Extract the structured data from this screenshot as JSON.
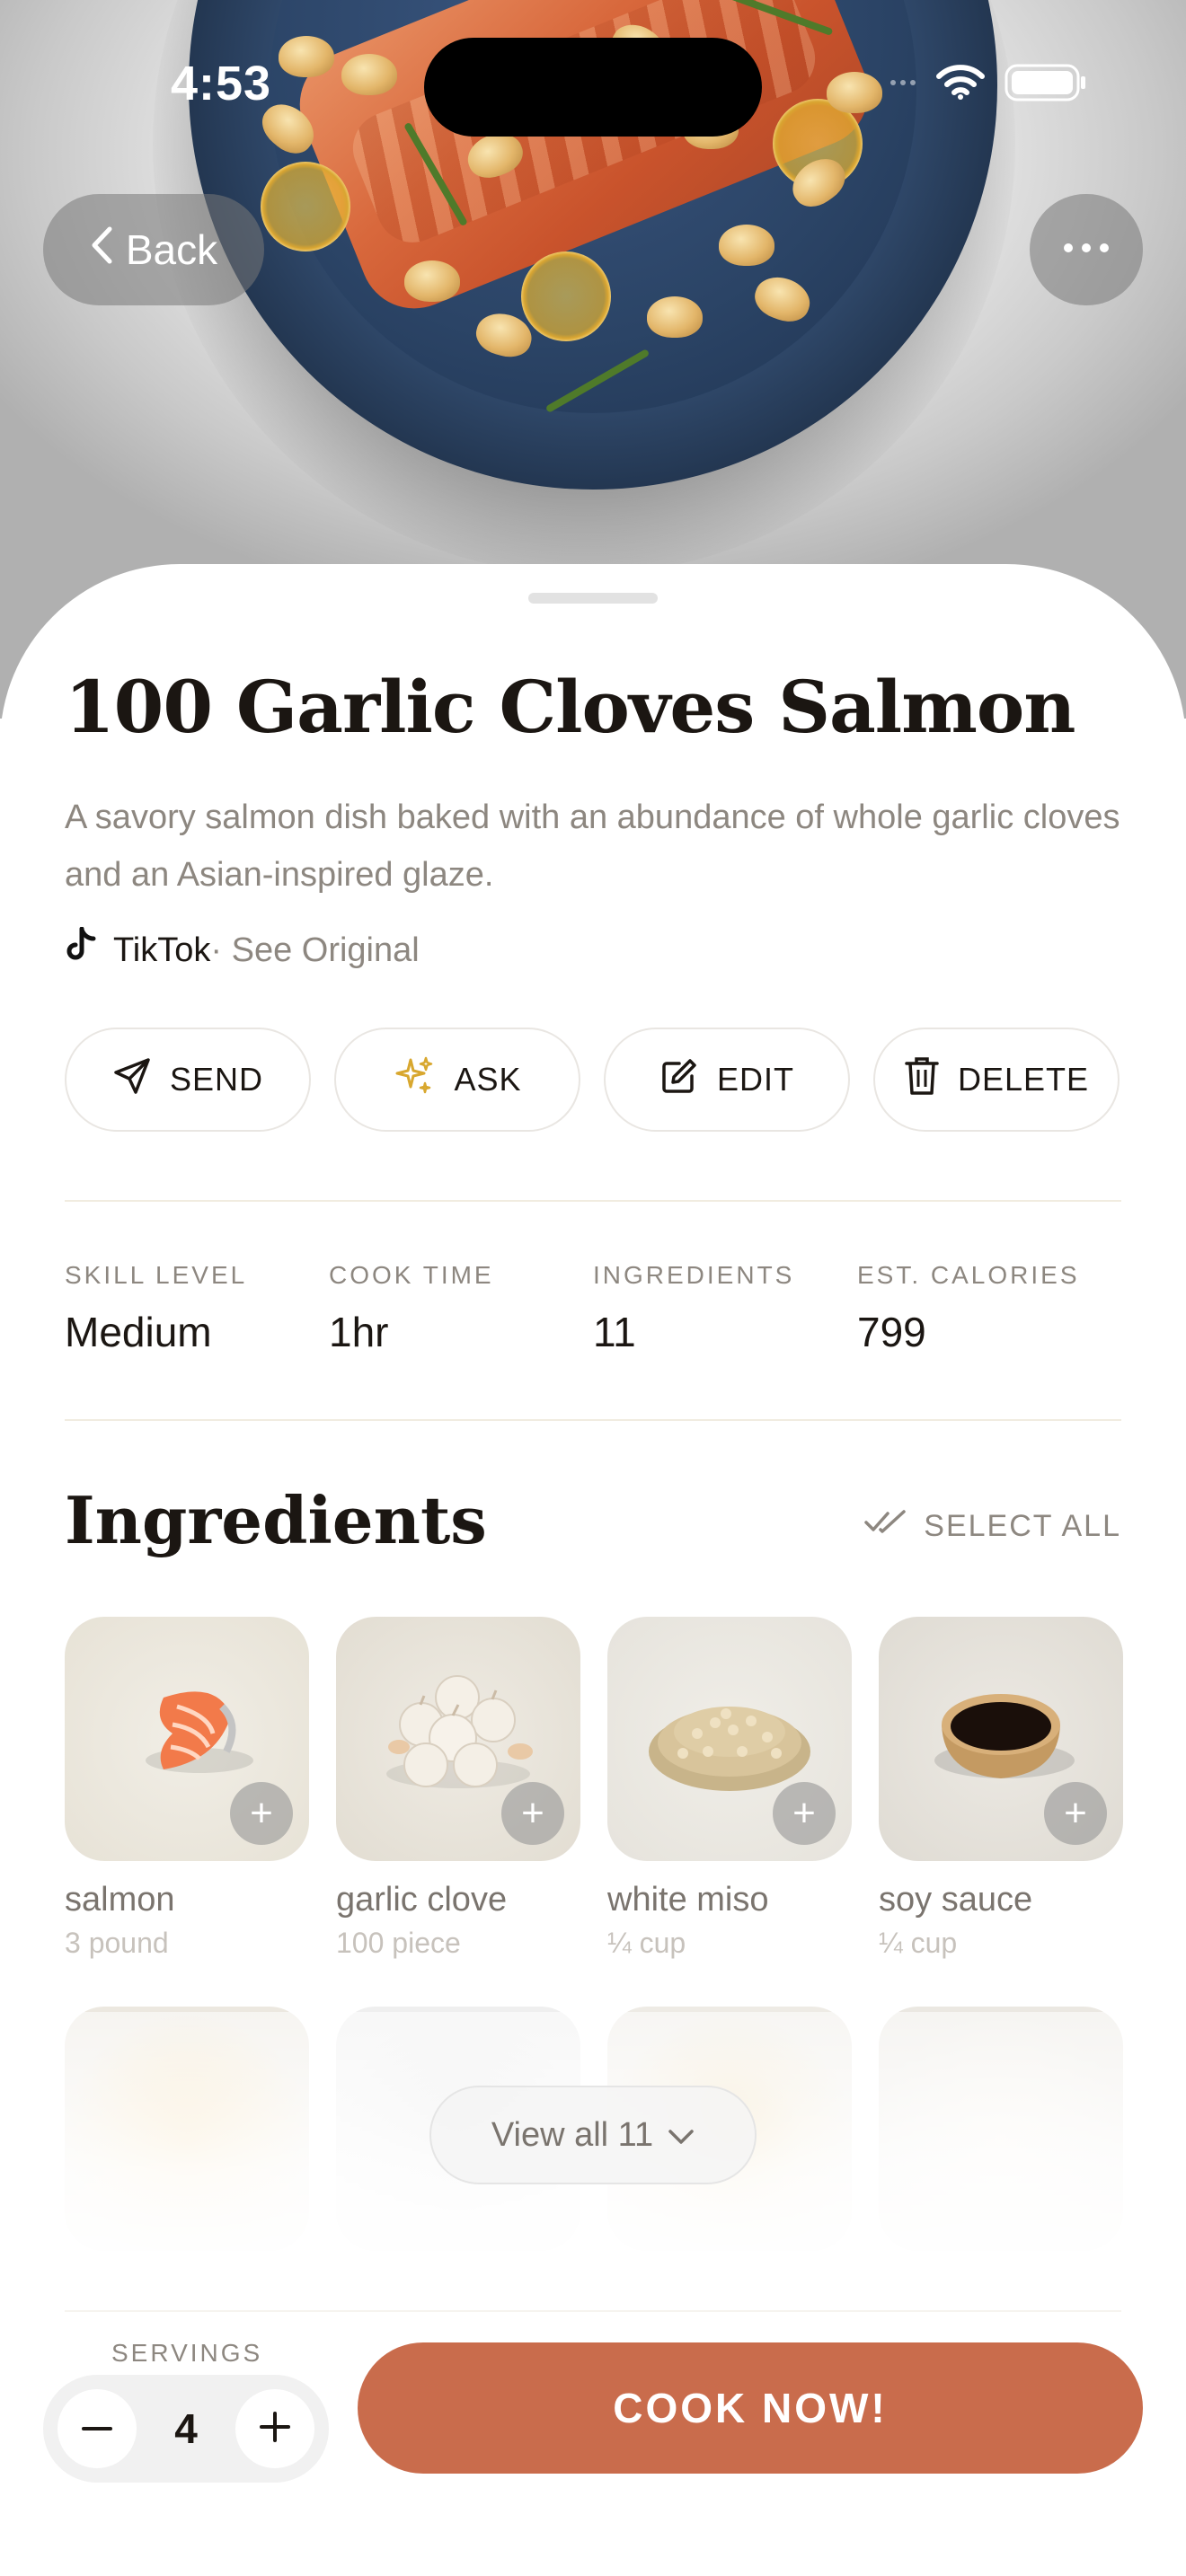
{
  "status_bar": {
    "time": "4:53"
  },
  "nav": {
    "back_label": "Back"
  },
  "recipe": {
    "title": "100 Garlic Cloves Salmon",
    "description": "A savory salmon dish baked with an abundance of whole garlic cloves and an Asian-inspired glaze.",
    "source_name": "TikTok",
    "source_link": " · See Original"
  },
  "actions": [
    {
      "label": "SEND",
      "icon": "send-icon"
    },
    {
      "label": "ASK",
      "icon": "sparkles-icon"
    },
    {
      "label": "EDIT",
      "icon": "edit-icon"
    },
    {
      "label": "DELETE",
      "icon": "trash-icon"
    }
  ],
  "stats": [
    {
      "label": "SKILL LEVEL",
      "value": "Medium"
    },
    {
      "label": "COOK TIME",
      "value": "1hr"
    },
    {
      "label": "INGREDIENTS",
      "value": "11"
    },
    {
      "label": "EST. CALORIES",
      "value": "799"
    }
  ],
  "ingredients_section": {
    "title": "Ingredients",
    "select_all_label": "SELECT ALL",
    "view_all_label": "View all 11",
    "items": [
      {
        "name": "salmon",
        "quantity": "3 pound"
      },
      {
        "name": "garlic clove",
        "quantity": "100 piece"
      },
      {
        "name": "white miso",
        "quantity": "¼ cup"
      },
      {
        "name": "soy sauce",
        "quantity": "¼ cup"
      }
    ]
  },
  "footer": {
    "servings_label": "SERVINGS",
    "servings_value": "4",
    "cook_label": "COOK NOW!"
  },
  "colors": {
    "accent": "#c96c4c",
    "heading": "#1b1612",
    "muted": "#8d8780",
    "gold": "#d8a72e"
  }
}
